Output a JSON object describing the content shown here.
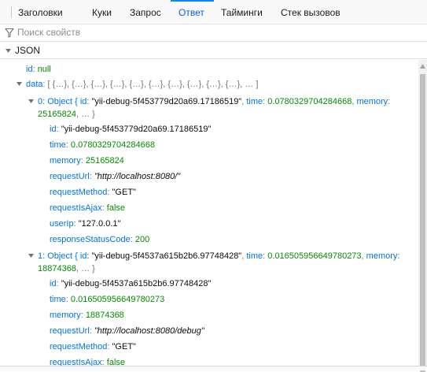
{
  "tabs": [
    {
      "label": "Заголовки",
      "active": false
    },
    {
      "label": "Куки",
      "active": false
    },
    {
      "label": "Запрос",
      "active": false
    },
    {
      "label": "Ответ",
      "active": true
    },
    {
      "label": "Тайминги",
      "active": false
    },
    {
      "label": "Стек вызовов",
      "active": false
    }
  ],
  "filter": {
    "placeholder": "Поиск свойств",
    "value": "",
    "icon": "filter-icon"
  },
  "section": {
    "title": "JSON"
  },
  "tree": {
    "id_row": {
      "key": "id",
      "value": "null"
    },
    "data_row": {
      "key": "data",
      "preview": "[ {…}, {…}, {…}, {…}, {…}, {…}, {…}, {…}, {…}, {…}, … ]"
    },
    "item0": {
      "index": "0",
      "summary_prefix": "Object { id: ",
      "summary_id": "\"yii-debug-5f453779d20a69.17186519\"",
      "summary_time_key": "time",
      "summary_time": "0.0780329704284668",
      "summary_memory_key": "memory",
      "summary_memory": "25165824",
      "summary_suffix": ", … }",
      "props": {
        "id": "\"yii-debug-5f453779d20a69.17186519\"",
        "time": "0.0780329704284668",
        "memory": "25165824",
        "requestUrl": "\"http://localhost:8080/\"",
        "requestMethod": "\"GET\"",
        "requestIsAjax": "false",
        "userIp": "\"127.0.0.1\"",
        "responseStatusCode": "200"
      }
    },
    "item1": {
      "index": "1",
      "summary_prefix": "Object { id: ",
      "summary_id": "\"yii-debug-5f4537a615b2b6.97748428\"",
      "summary_time_key": "time",
      "summary_time": "0.016505956649780273",
      "summary_memory_key": "memory",
      "summary_memory": "18874368",
      "summary_suffix": ", … }",
      "props": {
        "id": "\"yii-debug-5f4537a615b2b6.97748428\"",
        "time": "0.016505956649780273",
        "memory": "18874368",
        "requestUrl": "\"http://localhost:8080/debug\"",
        "requestMethod": "\"GET\"",
        "requestIsAjax": "false"
      }
    }
  },
  "colors": {
    "accent": "#0a84ff",
    "key": "#0074e8",
    "number": "#058b00"
  }
}
